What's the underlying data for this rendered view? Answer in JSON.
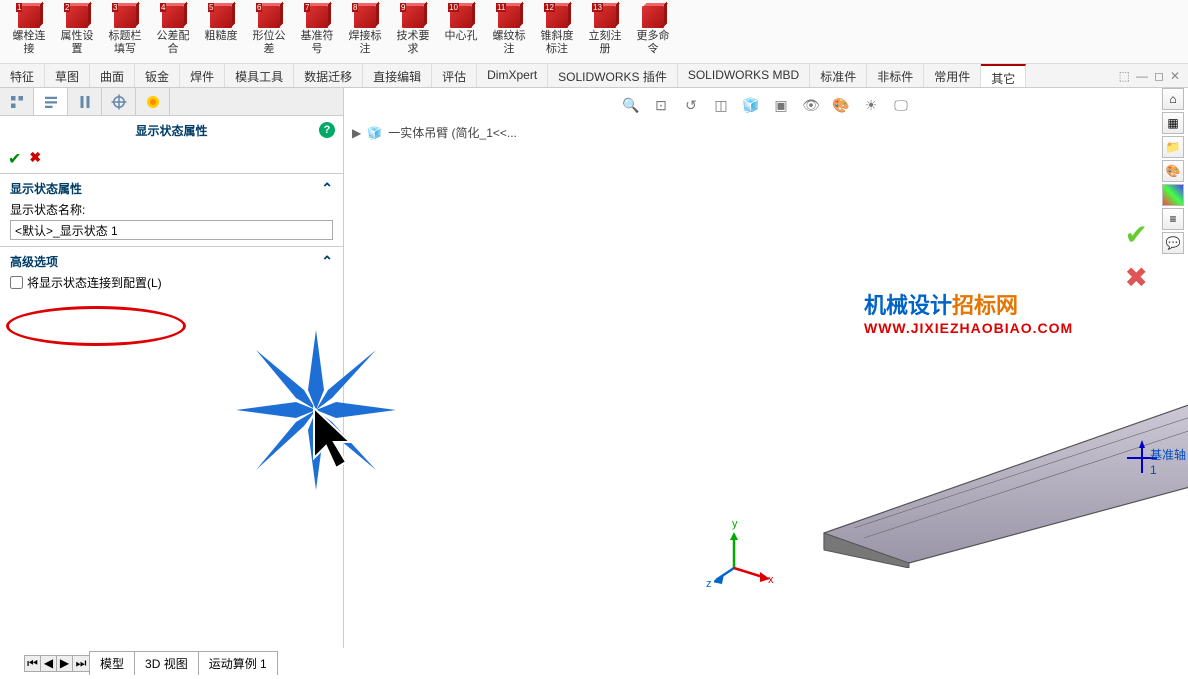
{
  "toolbar": [
    {
      "n": "1",
      "label": "螺栓连接"
    },
    {
      "n": "2",
      "label": "属性设置"
    },
    {
      "n": "3",
      "label": "标题栏填写"
    },
    {
      "n": "4",
      "label": "公差配合"
    },
    {
      "n": "5",
      "label": "粗糙度"
    },
    {
      "n": "6",
      "label": "形位公差"
    },
    {
      "n": "7",
      "label": "基准符号"
    },
    {
      "n": "8",
      "label": "焊接标注"
    },
    {
      "n": "9",
      "label": "技术要求"
    },
    {
      "n": "10",
      "label": "中心孔"
    },
    {
      "n": "11",
      "label": "螺纹标注"
    },
    {
      "n": "12",
      "label": "锥斜度标注"
    },
    {
      "n": "13",
      "label": "立刻注册"
    },
    {
      "n": "",
      "label": "更多命令"
    }
  ],
  "ribbon": [
    "特征",
    "草图",
    "曲面",
    "钣金",
    "焊件",
    "模具工具",
    "数据迁移",
    "直接编辑",
    "评估",
    "DimXpert",
    "SOLIDWORKS 插件",
    "SOLIDWORKS MBD",
    "标准件",
    "非标件",
    "常用件",
    "其它"
  ],
  "active_ribbon": 15,
  "panel": {
    "title": "显示状态属性",
    "section1": {
      "title": "显示状态属性",
      "label": "显示状态名称:",
      "value": "<默认>_显示状态 1"
    },
    "section2": {
      "title": "高级选项",
      "checkbox": "将显示状态连接到配置(L)"
    }
  },
  "breadcrumb": {
    "part": "一实体吊臂  (简化_1<<..."
  },
  "watermark": {
    "l1a": "机械设计",
    "l1b": "招标网",
    "l2": "WWW.JIXIEZHAOBIAO.COM"
  },
  "axis": "基准轴1",
  "axis_letters": {
    "x": "x",
    "y": "y",
    "z": "z"
  },
  "bottom": [
    "模型",
    "3D 视图",
    "运动算例 1"
  ]
}
